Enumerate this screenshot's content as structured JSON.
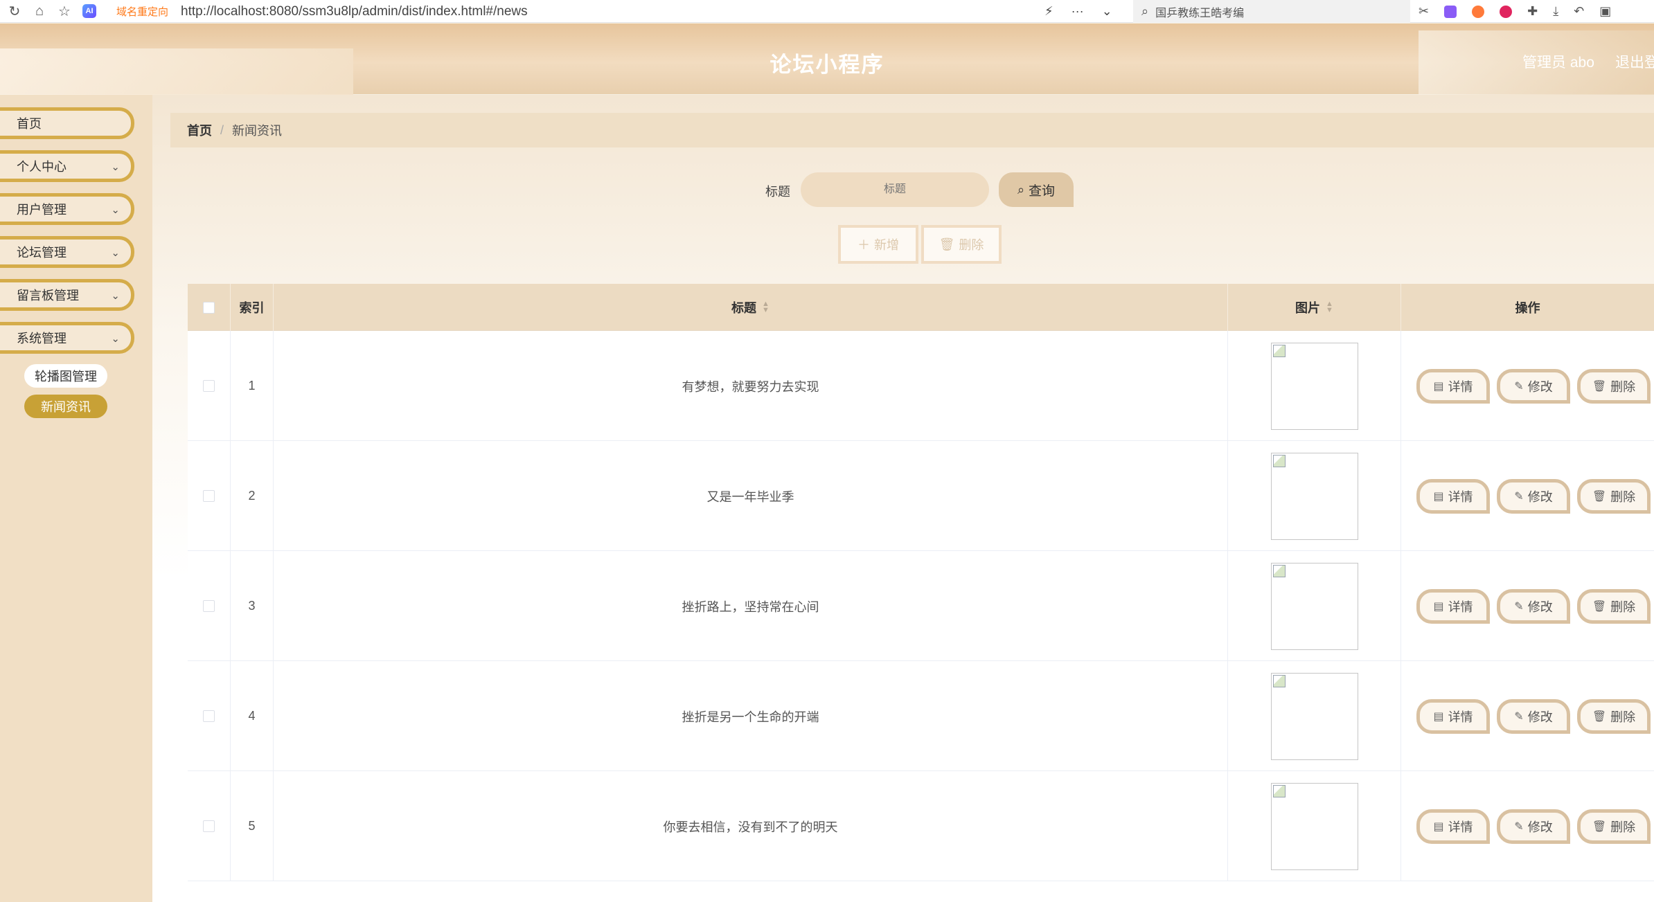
{
  "browser": {
    "redirect_tag": "域名重定向",
    "url": "http://localhost:8080/ssm3u8lp/admin/dist/index.html#/news",
    "search_text": "国乒教练王皓考编",
    "icons": [
      "refresh-icon",
      "home-icon",
      "favorite-icon",
      "ai-icon",
      "bolt-icon",
      "more-icon",
      "chevron-down-icon",
      "search-icon",
      "scissors-icon",
      "translate-icon",
      "extension-icon",
      "puzzle-icon",
      "download-icon",
      "undo-icon",
      "bag-icon"
    ]
  },
  "header": {
    "title": "论坛小程序",
    "user": "管理员 abo",
    "logout": "退出登录"
  },
  "sidebar": {
    "items": [
      {
        "label": "首页"
      },
      {
        "label": "个人中心"
      },
      {
        "label": "用户管理"
      },
      {
        "label": "论坛管理"
      },
      {
        "label": "留言板管理"
      },
      {
        "label": "系统管理"
      }
    ],
    "sub_items": [
      {
        "label": "轮播图管理",
        "active": false
      },
      {
        "label": "新闻资讯",
        "active": true
      }
    ]
  },
  "breadcrumb": {
    "home": "首页",
    "separator": "/",
    "current": "新闻资讯"
  },
  "search": {
    "label": "标题",
    "placeholder": "标题",
    "button": "查询"
  },
  "actions": {
    "add": "新增",
    "delete": "删除"
  },
  "table": {
    "columns": {
      "index": "索引",
      "title": "标题",
      "image": "图片",
      "ops": "操作"
    },
    "op_labels": {
      "detail": "详情",
      "edit": "修改",
      "delete": "删除"
    },
    "rows": [
      {
        "index": "1",
        "title": "有梦想，就要努力去实现"
      },
      {
        "index": "2",
        "title": "又是一年毕业季"
      },
      {
        "index": "3",
        "title": "挫折路上，坚持常在心间"
      },
      {
        "index": "4",
        "title": "挫折是另一个生命的开端"
      },
      {
        "index": "5",
        "title": "你要去相信，没有到不了的明天"
      }
    ]
  },
  "colors": {
    "accent": "#c8a136",
    "header_bg": "#e7c59c",
    "sidebar_bg": "#f1dfc5",
    "table_head_bg": "#ecdbc2"
  }
}
